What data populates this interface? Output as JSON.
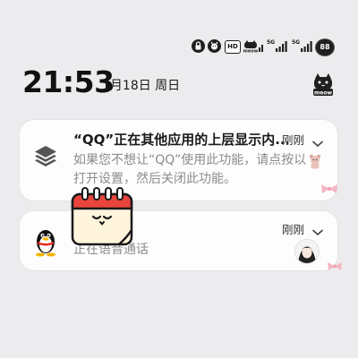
{
  "status_bar": {
    "icons": [
      "lock-cat-icon",
      "cat-face-icon",
      "hd-icon",
      "meow-signal-icon",
      "5g-signal-icon",
      "5g-signal-icon",
      "battery-icon"
    ],
    "hd_label": "HD",
    "net_1": "5G",
    "net_2": "5G",
    "battery_level": "88",
    "meow_label": "meow"
  },
  "lockscreen": {
    "time": "21:53",
    "date": "1月18日 周日",
    "badge_label": "meow"
  },
  "notifications": [
    {
      "app_icon": "layers-icon",
      "title": "“QQ”正在其他应用的上层显示内...",
      "time": "刚刚",
      "body": "如果您不想让“QQ”使用此功能，请点按以打开设置，然后关闭此功能。"
    },
    {
      "app_icon": "qq-penguin-icon",
      "title": "",
      "time": "刚刚",
      "body": "正在语音通话"
    }
  ],
  "colors": {
    "background": "#ececee",
    "card": "#fdfdfd",
    "text_primary": "#1a1a1a",
    "text_secondary": "#8c8c8c",
    "calendar_red": "#e8453c",
    "bow_pink": "#f4b6c2"
  }
}
